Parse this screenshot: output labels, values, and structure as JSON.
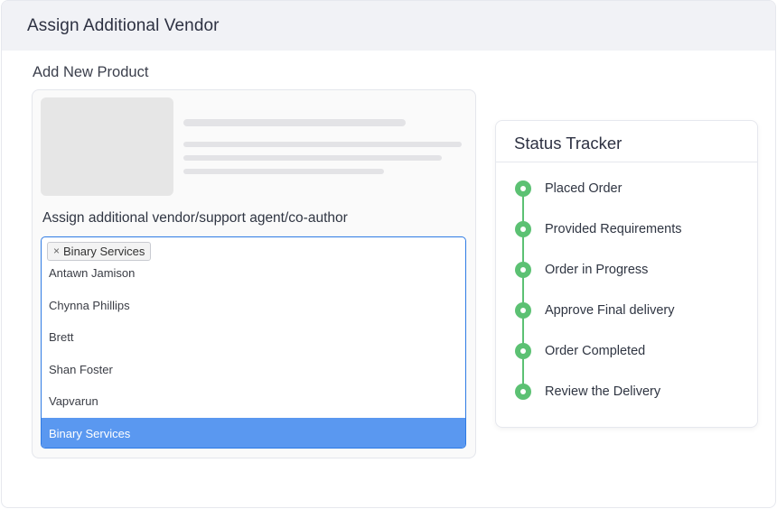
{
  "header": {
    "title": "Assign Additional Vendor"
  },
  "product": {
    "section_title": "Add New Product"
  },
  "assign": {
    "label": "Assign additional vendor/support agent/co-author",
    "selected_tag": "Binary Services",
    "tag_remove_symbol": "×",
    "options": [
      "Antawn Jamison",
      "Chynna Phillips",
      "Brett",
      "Shan Foster",
      "Vapvarun",
      "Binary Services"
    ],
    "highlighted_option": "Binary Services"
  },
  "tracker": {
    "title": "Status Tracker",
    "accent_color": "#5cc173",
    "steps": [
      "Placed Order",
      "Provided Requirements",
      "Order in Progress",
      "Approve Final delivery",
      "Order Completed",
      "Review the Delivery"
    ]
  }
}
